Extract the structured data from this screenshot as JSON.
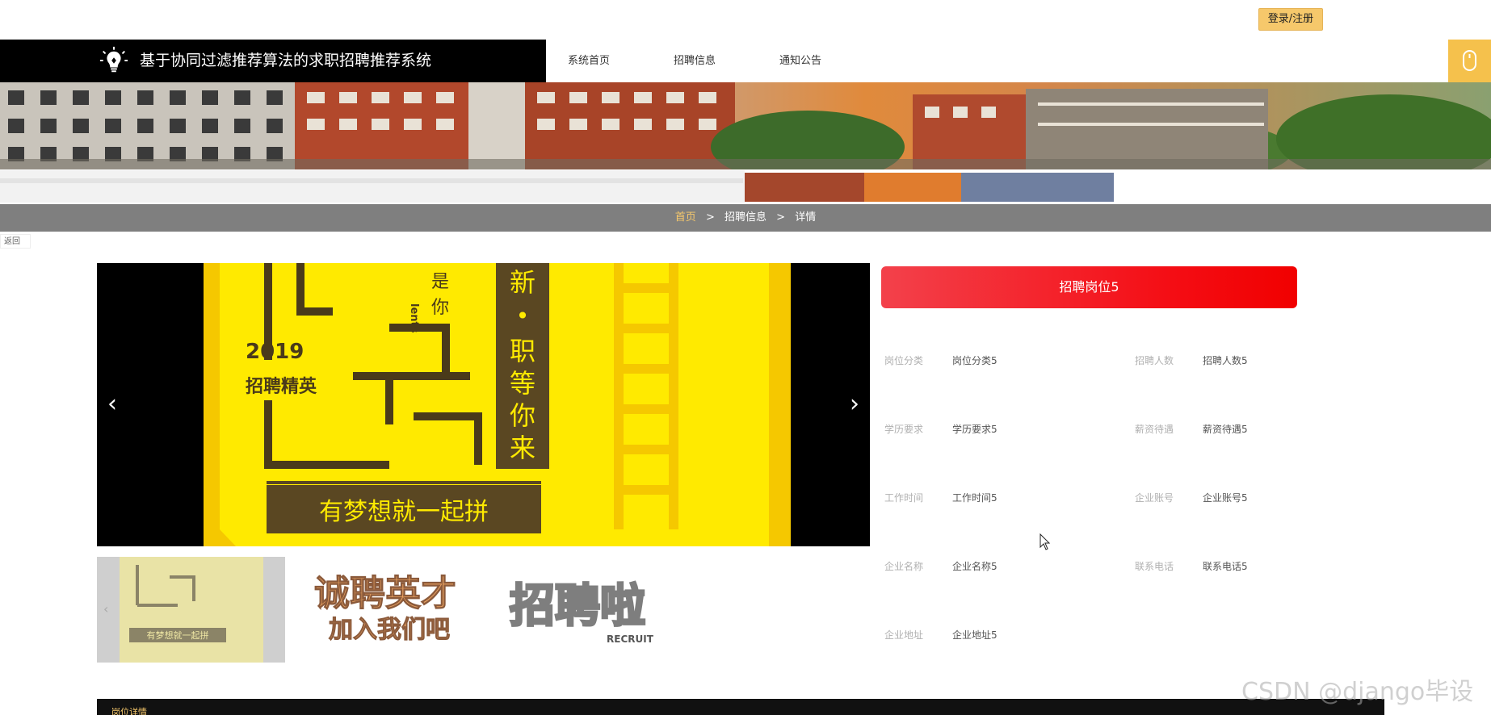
{
  "topbar": {
    "login_label": "登录/注册"
  },
  "header": {
    "title": "基于协同过滤推荐算法的求职招聘推荐系统",
    "nav": [
      {
        "label": "系统首页"
      },
      {
        "label": "招聘信息"
      },
      {
        "label": "通知公告"
      }
    ]
  },
  "breadcrumb": {
    "home": "首页",
    "separator": ">",
    "section": "招聘信息",
    "current": "详情"
  },
  "back_label": "返回",
  "carousel": {
    "poster": {
      "year": "2019",
      "subtitle": "招聘精英",
      "side_1": "是",
      "side_2": "你",
      "side_3": "lents",
      "vertical": [
        "新",
        "•",
        "职",
        "等",
        "你",
        "来"
      ],
      "slogan": "有梦想就一起拼"
    },
    "prev_symbol": "‹",
    "next_symbol": "›",
    "thumbs": [
      {
        "label": "有梦想就一起拼"
      },
      {
        "label_1": "诚聘英才",
        "label_2": "加入我们吧"
      },
      {
        "label": "招聘啦",
        "sub": "RECRUIT"
      }
    ]
  },
  "job": {
    "title": "招聘岗位5",
    "fields": [
      {
        "label": "岗位分类",
        "value": "岗位分类5"
      },
      {
        "label": "招聘人数",
        "value": "招聘人数5"
      },
      {
        "label": "学历要求",
        "value": "学历要求5"
      },
      {
        "label": "薪资待遇",
        "value": "薪资待遇5"
      },
      {
        "label": "工作时间",
        "value": "工作时间5"
      },
      {
        "label": "企业账号",
        "value": "企业账号5"
      },
      {
        "label": "企业名称",
        "value": "企业名称5"
      },
      {
        "label": "联系电话",
        "value": "联系电话5"
      },
      {
        "label": "企业地址",
        "value": "企业地址5"
      }
    ]
  },
  "bottom": {
    "detail_title": "岗位详情"
  },
  "watermark": "CSDN @django毕设",
  "colors": {
    "accent": "#f6c86b",
    "title_red": "#f40d14",
    "header_black": "#000000"
  }
}
